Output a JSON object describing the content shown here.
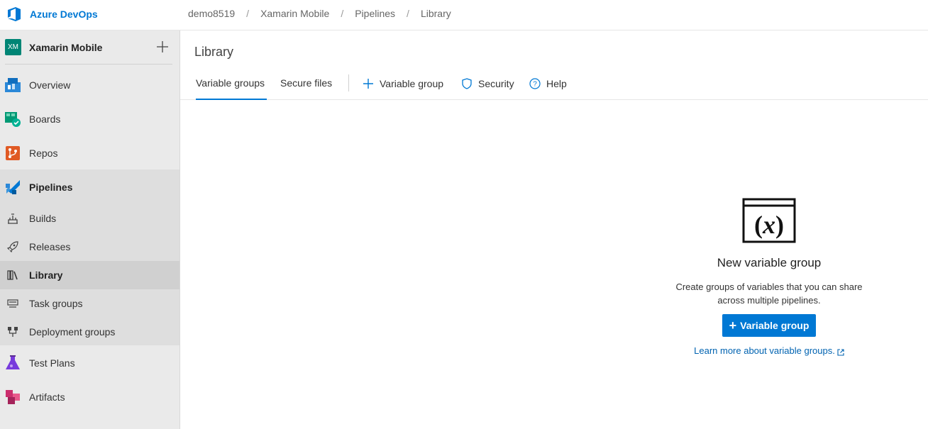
{
  "header": {
    "brand": "Azure DevOps",
    "breadcrumbs": [
      "demo8519",
      "Xamarin Mobile",
      "Pipelines",
      "Library"
    ]
  },
  "sidebar": {
    "project_initials": "XM",
    "project_name": "Xamarin Mobile",
    "items": [
      {
        "label": "Overview",
        "icon": "overview-icon"
      },
      {
        "label": "Boards",
        "icon": "boards-icon"
      },
      {
        "label": "Repos",
        "icon": "repos-icon"
      },
      {
        "label": "Pipelines",
        "icon": "pipelines-icon"
      },
      {
        "label": "Builds",
        "icon": "builds-icon"
      },
      {
        "label": "Releases",
        "icon": "releases-icon"
      },
      {
        "label": "Library",
        "icon": "library-icon",
        "selected": true
      },
      {
        "label": "Task groups",
        "icon": "task-groups-icon"
      },
      {
        "label": "Deployment groups",
        "icon": "deployment-groups-icon"
      },
      {
        "label": "Test Plans",
        "icon": "test-plans-icon"
      },
      {
        "label": "Artifacts",
        "icon": "artifacts-icon"
      }
    ]
  },
  "main": {
    "title": "Library",
    "tabs": [
      {
        "label": "Variable groups",
        "active": true
      },
      {
        "label": "Secure files",
        "active": false
      }
    ],
    "toolbar": {
      "add_variable_group": "Variable group",
      "security": "Security",
      "help": "Help"
    },
    "empty_state": {
      "title": "New variable group",
      "description_line1": "Create groups of variables that you can share",
      "description_line2": "across multiple pipelines.",
      "button_label": "Variable group",
      "learn_more": "Learn more about variable groups."
    }
  },
  "colors": {
    "accent": "#0078d4",
    "project_avatar": "#008575",
    "sidebar_bg": "#eaeaea"
  }
}
